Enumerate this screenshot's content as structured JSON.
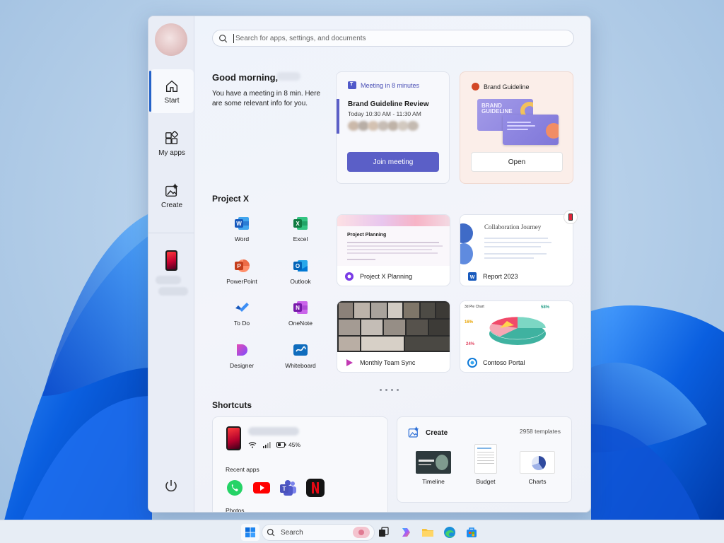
{
  "search": {
    "placeholder": "Search for apps, settings, and documents"
  },
  "rail": {
    "items": [
      {
        "label": "Start",
        "icon": "home-icon",
        "active": true
      },
      {
        "label": "My apps",
        "icon": "apps-grid-icon"
      },
      {
        "label": "Create",
        "icon": "create-image-icon"
      }
    ],
    "power_icon": "power-icon"
  },
  "greeting": {
    "title": "Good morning,",
    "subtitle": "You have a meeting in 8 min. Here are some relevant info for you."
  },
  "meeting_card": {
    "badge": "Meeting in 8 minutes",
    "title": "Brand Guideline Review",
    "time": "Today 10:30 AM - 11:30 AM",
    "button": "Join meeting",
    "accent": "#5b5fc7"
  },
  "brand_card": {
    "title": "Brand Guideline",
    "slide_text": "BRAND GUIDELINE",
    "button": "Open"
  },
  "project": {
    "title": "Project X",
    "apps": [
      {
        "label": "Word",
        "icon": "word-icon"
      },
      {
        "label": "Excel",
        "icon": "excel-icon"
      },
      {
        "label": "PowerPoint",
        "icon": "powerpoint-icon"
      },
      {
        "label": "Outlook",
        "icon": "outlook-icon"
      },
      {
        "label": "To Do",
        "icon": "todo-icon"
      },
      {
        "label": "OneNote",
        "icon": "onenote-icon"
      },
      {
        "label": "Designer",
        "icon": "designer-icon"
      },
      {
        "label": "Whiteboard",
        "icon": "whiteboard-icon"
      }
    ],
    "files": [
      {
        "label": "Project X Planning",
        "thumb_title": "Project Planning"
      },
      {
        "label": "Report 2023",
        "thumb_title": "Collaboration Journey"
      },
      {
        "label": "Monthly Team Sync"
      },
      {
        "label": "Contoso Portal",
        "thumb_title": "3d Pie Chart",
        "values": [
          "58%",
          "16%",
          "24%"
        ]
      }
    ]
  },
  "shortcuts": {
    "title": "Shortcuts",
    "phone": {
      "battery": "45%",
      "recent_label": "Recent apps",
      "photos_label": "Photos"
    },
    "create": {
      "title": "Create",
      "count": "2958 templates",
      "templates": [
        {
          "label": "Timeline"
        },
        {
          "label": "Budget"
        },
        {
          "label": "Charts"
        }
      ]
    }
  },
  "taskbar": {
    "search_label": "Search"
  }
}
